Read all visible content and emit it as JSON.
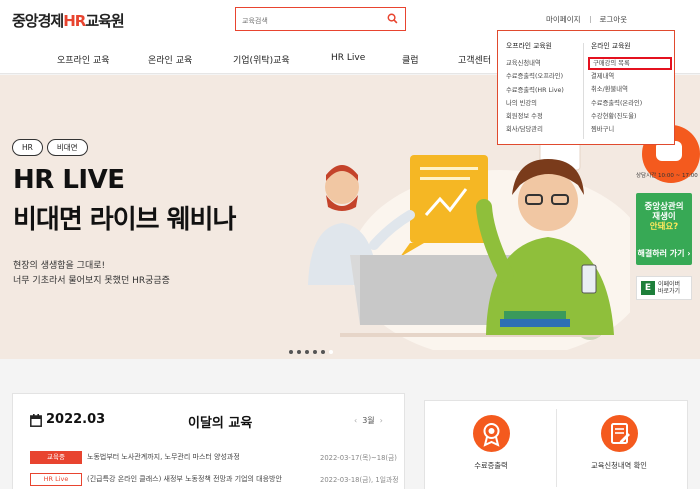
{
  "header": {
    "logo_pre": "중앙경제",
    "logo_hr": "HR",
    "logo_post": "교육원",
    "search_placeholder": "교육검색",
    "top_links": [
      "마이페이지",
      "로그아웃"
    ]
  },
  "nav": [
    "오프라인 교육",
    "온라인 교육",
    "기업(위탁)교육",
    "HR Live",
    "클럽",
    "고객센터"
  ],
  "dropdown": {
    "offline": {
      "heading": "오프라인 교육원",
      "items": [
        "교육신청내역",
        "수료증출력(오프라인)",
        "수료증출력(HR Live)",
        "나의 빈강의",
        "회원정보 수정",
        "회사/담당관리"
      ]
    },
    "online": {
      "heading": "온라인 교육원",
      "items": [
        "구매강의 목록",
        "결제내역",
        "취소/환불내역",
        "수료증출력(온라인)",
        "수강현황(진도율)",
        "찜바구니"
      ]
    }
  },
  "hero": {
    "tags": [
      "HR",
      "비대면"
    ],
    "title1": "HR LIVE",
    "title2": "비대면 라이브 웨비나",
    "sub1": "현장의 생생함을 그대로!",
    "sub2": "너무 기초라서 물어보지 못했던 HR궁금증",
    "slides": 6,
    "active_slide": 5
  },
  "side": {
    "time": "상담시간   10:00 ~ 17:00",
    "green_line1": "중앙상관의",
    "green_line2": "재생이",
    "green_line3": "안돼요?",
    "green_btn": "해결하러 가기 ›",
    "e_line1": "이페이버",
    "e_line2": "바로가기"
  },
  "monthly": {
    "date": "2022.03",
    "title": "이달의 교육",
    "month_nav": "3월",
    "rows": [
      {
        "badge": "교육중",
        "title": "노동법부터 노사관계까지, 노무관리 마스터 양성과정",
        "date": "2022-03-17(목)~18(금)"
      },
      {
        "badge": "HR Live",
        "title": "(긴급특강 온라인 클래스) 새정부 노동정책 전망과 기업의 대응방안",
        "date": "2022-03-18(금), 1일과정"
      }
    ]
  },
  "quick": [
    {
      "icon": "certificate-icon",
      "label": "수료증출력"
    },
    {
      "icon": "checklist-icon",
      "label": "교육신청내역 확인"
    }
  ],
  "colors": {
    "accent": "#e8442f",
    "orange": "#f45a1e",
    "green": "#37a955",
    "hero_bg": "#f3e9e1"
  }
}
